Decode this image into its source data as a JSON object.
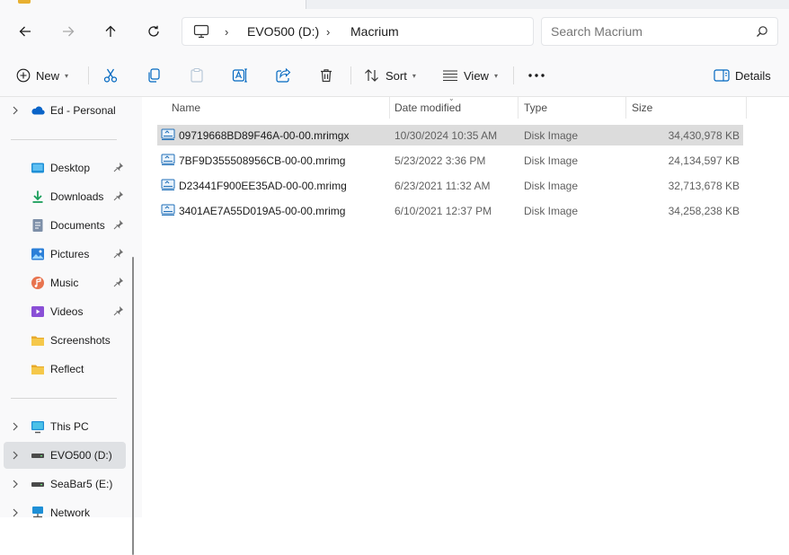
{
  "window": {
    "tab_icon": "folder-icon"
  },
  "address": {
    "crumbs": [
      "EVO500 (D:)",
      "Macrium"
    ],
    "search_placeholder": "Search Macrium"
  },
  "toolbar": {
    "new_label": "New",
    "sort_label": "Sort",
    "view_label": "View",
    "details_label": "Details"
  },
  "nav": {
    "personal": "Ed - Personal",
    "quick": [
      {
        "label": "Desktop",
        "icon": "desktop-icon",
        "pinned": true
      },
      {
        "label": "Downloads",
        "icon": "downloads-icon",
        "pinned": true
      },
      {
        "label": "Documents",
        "icon": "documents-icon",
        "pinned": true
      },
      {
        "label": "Pictures",
        "icon": "pictures-icon",
        "pinned": true
      },
      {
        "label": "Music",
        "icon": "music-icon",
        "pinned": true
      },
      {
        "label": "Videos",
        "icon": "videos-icon",
        "pinned": true
      },
      {
        "label": "Screenshots",
        "icon": "folder-icon",
        "pinned": false
      },
      {
        "label": "Reflect",
        "icon": "folder-icon",
        "pinned": false
      }
    ],
    "devices": [
      {
        "label": "This PC",
        "icon": "this-pc-icon"
      },
      {
        "label": "EVO500 (D:)",
        "icon": "drive-icon",
        "selected": true
      },
      {
        "label": "SeaBar5 (E:)",
        "icon": "drive-icon"
      },
      {
        "label": "Network",
        "icon": "network-icon"
      }
    ]
  },
  "columns": [
    "Name",
    "Date modified",
    "Type",
    "Size"
  ],
  "files": [
    {
      "name": "09719668BD89F46A-00-00.mrimgx",
      "date": "10/30/2024 10:35 AM",
      "type": "Disk Image",
      "size": "34,430,978 KB",
      "selected": true
    },
    {
      "name": "7BF9D355508956CB-00-00.mrimg",
      "date": "5/23/2022 3:36 PM",
      "type": "Disk Image",
      "size": "24,134,597 KB"
    },
    {
      "name": "D23441F900EE35AD-00-00.mrimg",
      "date": "6/23/2021 11:32 AM",
      "type": "Disk Image",
      "size": "32,713,678 KB"
    },
    {
      "name": "3401AE7A55D019A5-00-00.mrimg",
      "date": "6/10/2021 12:37 PM",
      "type": "Disk Image",
      "size": "34,258,238 KB"
    }
  ],
  "colors": {
    "accent": "#0067c0",
    "folder": "#f3c343",
    "selection": "#dcdcdc"
  }
}
